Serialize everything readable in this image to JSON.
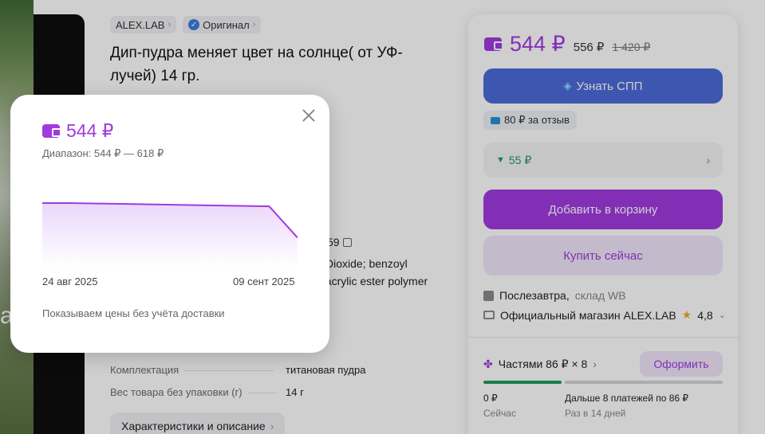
{
  "product": {
    "brand": "ALEX.LAB",
    "original_label": "Оригинал",
    "title": "Дип-пудра меняет цвет на солнце( от УФ-лучей) 14 гр.",
    "article_fragment": "59",
    "composition_line1": "Dioxide; benzoyl",
    "composition_line2": "; acrylic ester polymer",
    "specs": [
      {
        "key": "Комплектация",
        "value": "титановая пудра"
      },
      {
        "key": "Вес товара без упаковки (г)",
        "value": "14 г"
      }
    ],
    "description_button": "Характеристики и описание",
    "overlay_letter": "а"
  },
  "card": {
    "price": "544 ₽",
    "price_without_wallet": "556 ₽",
    "price_old": "1 420 ₽",
    "spp_button": "Узнать СПП",
    "review_bonus": "80 ₽ за отзыв",
    "price_drop": "55 ₽",
    "add_to_cart": "Добавить в корзину",
    "buy_now": "Купить сейчас",
    "delivery_label": "Послезавтра,",
    "delivery_warehouse": "склад WB",
    "shop_label": "Официальный магазин ALEX.LAB",
    "rating": "4,8",
    "installments_label": "Частями 86 ₽ × 8",
    "installments_button": "Оформить",
    "pay_now_value": "0 ₽",
    "pay_now_label": "Сейчас",
    "pay_later_value": "Дальше 8 платежей по 86 ₽",
    "pay_later_label": "Раз в 14 дней"
  },
  "popup": {
    "price": "544 ₽",
    "range": "Диапазон: 544 ₽ — 618 ₽",
    "date_start": "24 авг 2025",
    "date_end": "09 сент 2025",
    "note": "Показываем цены без учёта доставки"
  },
  "chart_data": {
    "type": "area",
    "x": [
      "24 авг 2025",
      "09 сент 2025"
    ],
    "series": [
      {
        "values": [
          618,
          618,
          617,
          616,
          615,
          614,
          613,
          612,
          611,
          544
        ]
      }
    ],
    "range_label": "544 ₽ — 618 ₽",
    "colors": {
      "line": "#a03be0",
      "fill": "#f1e6fb"
    }
  },
  "colors": {
    "accent": "#a03be0",
    "spp": "#4c6ad8",
    "drop": "#1f9a5a"
  }
}
